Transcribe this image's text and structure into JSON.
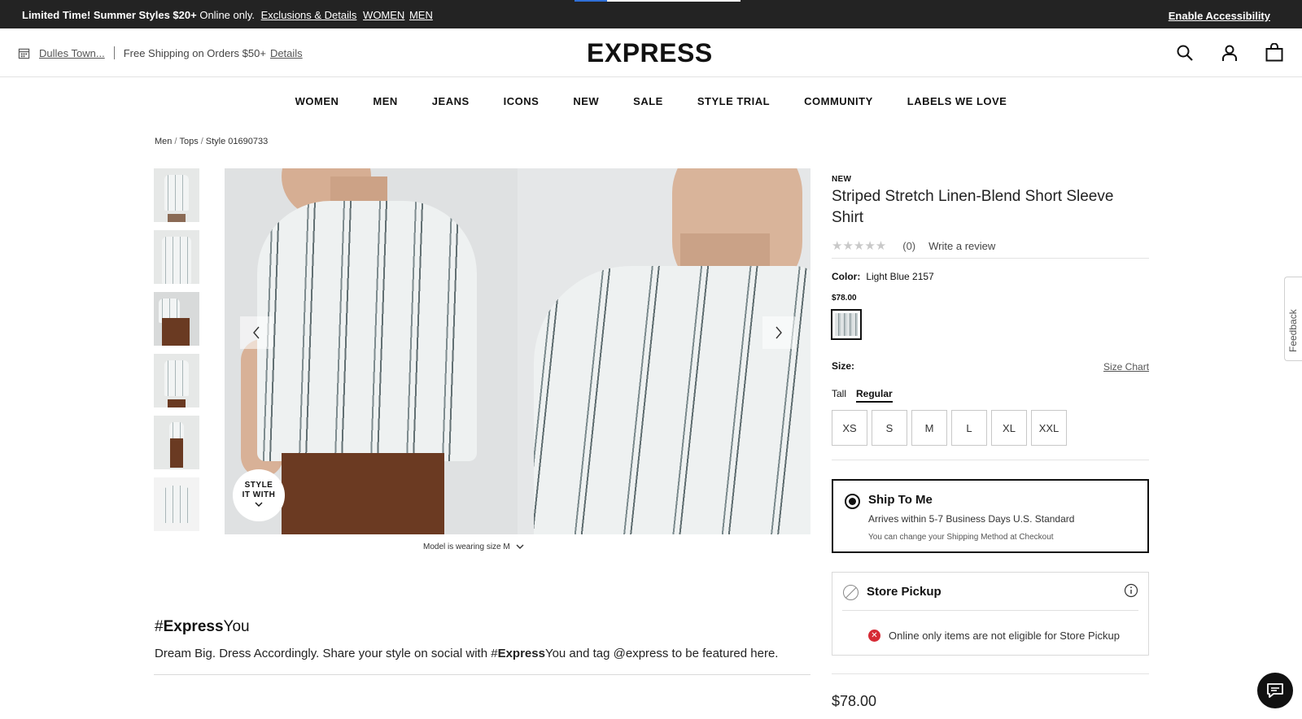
{
  "promo": {
    "headline": "Limited Time! Summer Styles $20+",
    "online": " Online only.",
    "exclusions": "Exclusions & Details",
    "women": "WOMEN",
    "men": "MEN",
    "accessibility": "Enable Accessibility"
  },
  "header": {
    "store": "Dulles Town...",
    "shipping": "Free Shipping on Orders $50+",
    "details": "Details",
    "logo": "EXPRESS"
  },
  "nav": [
    "WOMEN",
    "MEN",
    "JEANS",
    "ICONS",
    "NEW",
    "SALE",
    "STYLE TRIAL",
    "COMMUNITY",
    "LABELS WE LOVE"
  ],
  "breadcrumb": {
    "c1": "Men",
    "c2": "Tops",
    "c3": "Style 01690733"
  },
  "gallery": {
    "style_it_line1": "STYLE",
    "style_it_line2": "IT WITH",
    "model_note": "Model is wearing size M"
  },
  "product": {
    "badge": "NEW",
    "title": "Striped Stretch Linen-Blend Short Sleeve Shirt",
    "stars": "★★★★★",
    "review_count": "(0)",
    "write_review": "Write a review",
    "color_label": "Color:",
    "color_value": "Light Blue 2157",
    "price_small": "$78.00",
    "size_label": "Size:",
    "size_chart": "Size Chart",
    "fits": [
      "Tall",
      "Regular"
    ],
    "sizes": [
      "XS",
      "S",
      "M",
      "L",
      "XL",
      "XXL"
    ],
    "price": "$78.00"
  },
  "shipping": {
    "ship_title": "Ship To Me",
    "ship_line1": "Arrives within 5-7 Business Days U.S. Standard",
    "ship_line2": "You can change your Shipping Method at Checkout",
    "pickup_title": "Store Pickup",
    "pickup_error": "Online only items are not eligible for Store Pickup"
  },
  "expressyou": {
    "hash": "#",
    "brand": "Express",
    "you": "You",
    "text_before": "Dream Big. Dress Accordingly. Share your style on social with #",
    "text_brand": "Express",
    "text_after": "You and tag @express to be featured here."
  },
  "feedback": "Feedback",
  "icons": {
    "search": "search-icon",
    "account": "account-icon",
    "bag": "bag-icon",
    "store": "store-icon",
    "chat": "chat-icon",
    "info": "info-icon"
  }
}
